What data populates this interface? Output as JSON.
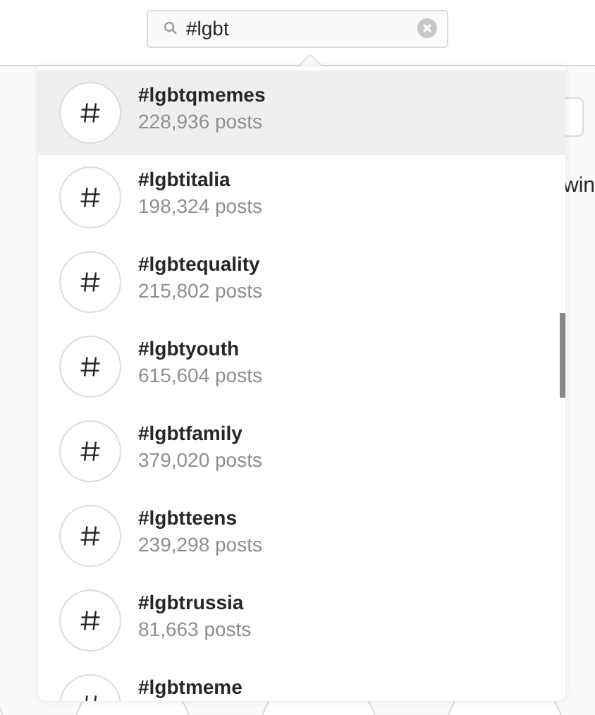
{
  "search": {
    "value": "#lgbt"
  },
  "results": [
    {
      "name": "#lgbtqmemes",
      "count": "228,936 posts",
      "selected": true
    },
    {
      "name": "#lgbtitalia",
      "count": "198,324 posts",
      "selected": false
    },
    {
      "name": "#lgbtequality",
      "count": "215,802 posts",
      "selected": false
    },
    {
      "name": "#lgbtyouth",
      "count": "615,604 posts",
      "selected": false
    },
    {
      "name": "#lgbtfamily",
      "count": "379,020 posts",
      "selected": false
    },
    {
      "name": "#lgbtteens",
      "count": "239,298 posts",
      "selected": false
    },
    {
      "name": "#lgbtrussia",
      "count": "81,663 posts",
      "selected": false
    },
    {
      "name": "#lgbtmeme",
      "selected": false
    }
  ],
  "background": {
    "text": "win"
  }
}
